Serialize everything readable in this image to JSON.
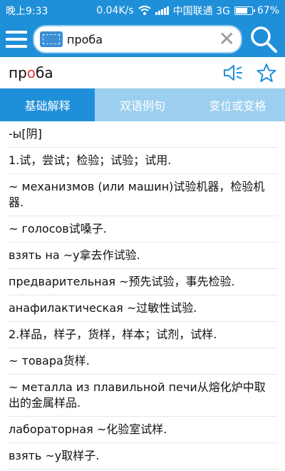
{
  "status_bar": {
    "time": "晚上9:33",
    "speed": "0.04K/s",
    "carrier": "中国联通 3G",
    "battery_text": "67%",
    "battery_level": 0.67
  },
  "search": {
    "query": "проба"
  },
  "entry": {
    "headword_pre": "пр",
    "headword_accent": "о",
    "headword_post": "ба"
  },
  "tabs": [
    {
      "label": "基础解释"
    },
    {
      "label": "双语例句"
    },
    {
      "label": "变位或变格"
    }
  ],
  "definitions": [
    "-ы[阴]",
    "1.试，尝试；检验；试验；试用.",
    "~ механизмов (или машин)试验机器，检验机器.",
    "~ голосов试嗓子.",
    "взять на ~у拿去作试验.",
    "предварительная ~预先试验，事先检验.",
    "анафилактическая ~过敏性试验.",
    "2.样品，样子，货样，样本；试剂，试样.",
    "~ товара货样.",
    "~ металла из плавильной печи从熔化炉中取出的金属样品.",
    "лабораторная ~化验室试样.",
    "взять ~у取样子."
  ],
  "colors": {
    "primary": "#1f8fd9",
    "tab_inactive": "#9ccfef",
    "accent": "#e53935"
  },
  "icons": {
    "menu": "hamburger",
    "keyboard": "keyboard-icon",
    "clear": "close-icon",
    "search": "search-icon",
    "speaker": "speaker-icon",
    "favorite": "star-icon"
  }
}
